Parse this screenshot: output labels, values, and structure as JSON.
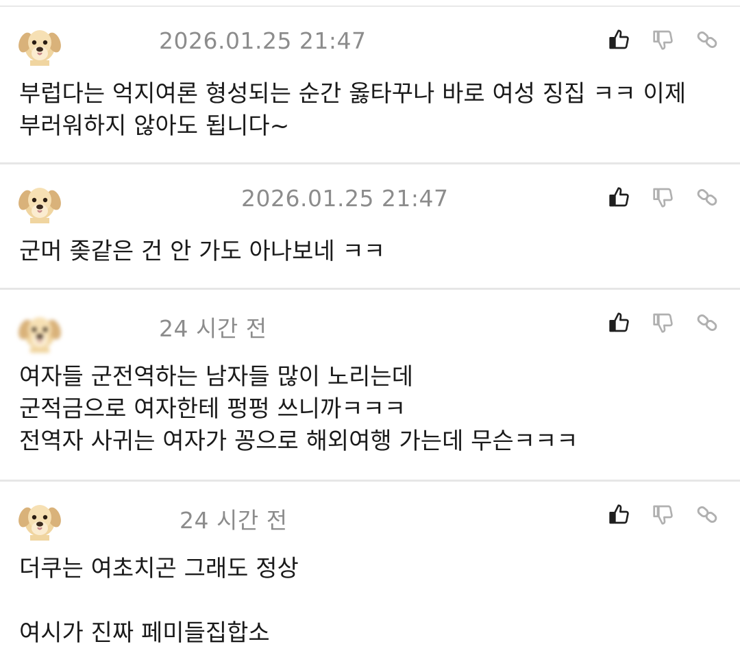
{
  "comments": [
    {
      "timestamp": "2026.01.25 21:47",
      "lines": [
        "부럽다는 억지여론 형성되는 순간 옳타꾸나 바로 여성 징집 ㅋㅋ 이제",
        "부러워하지 않아도 됩니다~"
      ]
    },
    {
      "timestamp": "2026.01.25 21:47",
      "lines": [
        "군머 좆같은 건 안 가도 아나보네 ㅋㅋ"
      ]
    },
    {
      "timestamp": "24 시간 전",
      "lines": [
        "여자들 군전역하는 남자들 많이 노리는데",
        "군적금으로 여자한테 펑펑 쓰니까ㅋㅋㅋ",
        "전역자 사귀는 여자가 꽁으로 해외여행 가는데 무슨ㅋㅋㅋ"
      ]
    },
    {
      "timestamp": "24 시간 전",
      "lines": [
        "더쿠는 여초치곤 그래도 정상",
        "",
        "여시가 진짜 페미들집합소"
      ]
    }
  ],
  "icons": {
    "avatar": "puppy-avatar-icon",
    "like": "thumbs-up-icon",
    "dislike": "thumbs-down-icon",
    "share": "link-icon"
  },
  "colors": {
    "timestamp": "#8c8c8c",
    "icon_active": "#1f1f1f",
    "icon_muted": "#b0b0b0",
    "divider": "#e6e6e6"
  }
}
